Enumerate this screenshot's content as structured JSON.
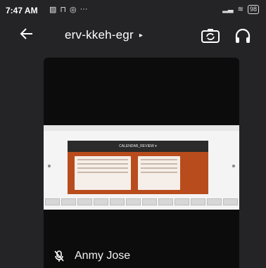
{
  "status_bar": {
    "time": "7:47 AM",
    "left_icons": [
      "gallery-icon",
      "notification-icon",
      "whatsapp-icon"
    ],
    "more": "···",
    "battery": "98"
  },
  "header": {
    "back_icon": "arrow-left-icon",
    "meeting_code": "erv-kkeh-egr",
    "caret": "▸",
    "camera_switch_icon": "camera-switch-icon",
    "audio_icon": "headphones-icon"
  },
  "video": {
    "slide_header_text": "CALENDAR_REVIEW ▾"
  },
  "participant": {
    "mic_icon": "mic-off-icon",
    "name": "Anmy Jose"
  }
}
